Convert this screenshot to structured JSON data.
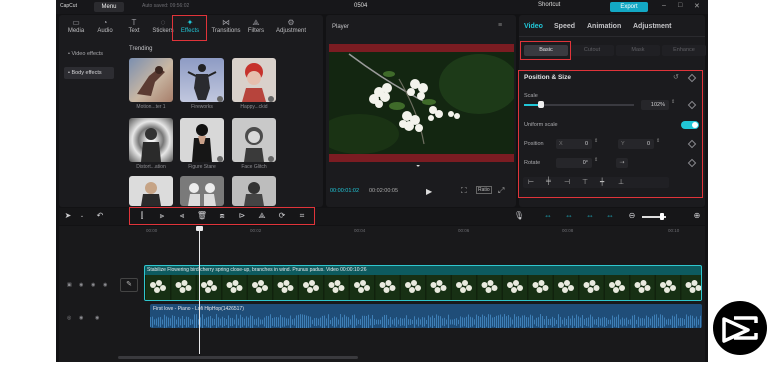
{
  "titlebar": {
    "logo": "CapCut",
    "menu": "Menu",
    "autosave": "Auto saved: 09:56:02",
    "project": "0504",
    "shortcut": "Shortcut",
    "export": "Export"
  },
  "tool_tabs": [
    "Media",
    "Audio",
    "Text",
    "Stickers",
    "Effects",
    "Transitions",
    "Filters",
    "Adjustment"
  ],
  "effects": {
    "sidebar": [
      "• Video effects",
      "• Body effects"
    ],
    "section": "Trending",
    "items": [
      "Motion...ter 1",
      "Fireworks",
      "Happy...ckid",
      "Distort...ation",
      "Figure Stare",
      "Face Glitch",
      "",
      "",
      ""
    ]
  },
  "player": {
    "title": "Player",
    "current_time": "00:00:01:02",
    "duration": "00:02:00:05",
    "ratio": "Ratio"
  },
  "inspector": {
    "tabs": [
      "Video",
      "Speed",
      "Animation",
      "Adjustment"
    ],
    "subtabs": [
      "Basic",
      "Cutout",
      "Mask",
      "Enhance"
    ],
    "section": "Position & Size",
    "scale_label": "Scale",
    "scale_value": "102%",
    "scale_fraction": 0.15,
    "uniform_label": "Uniform scale",
    "position_label": "Position",
    "pos_x_label": "X",
    "pos_x": "0",
    "pos_y_label": "Y",
    "pos_y": "0",
    "rotate_label": "Rotate",
    "rotate_value": "0°"
  },
  "timeline": {
    "ruler": [
      "00:00",
      "00:02",
      "00:04",
      "00:06",
      "00:08",
      "00:10"
    ],
    "video_clip": "Stabilize   Flowering bird cherry spring close-up, branches in wind. Prunus padus. Video   00:00:10:26",
    "audio_clip": "First love - Piano - Lofi HipHop(1426517)"
  },
  "colors": {
    "accent": "#21c6d7",
    "highlight_box": "#e0343a",
    "video_track": "#0d5b5f",
    "audio_track": "#1f4d78"
  }
}
